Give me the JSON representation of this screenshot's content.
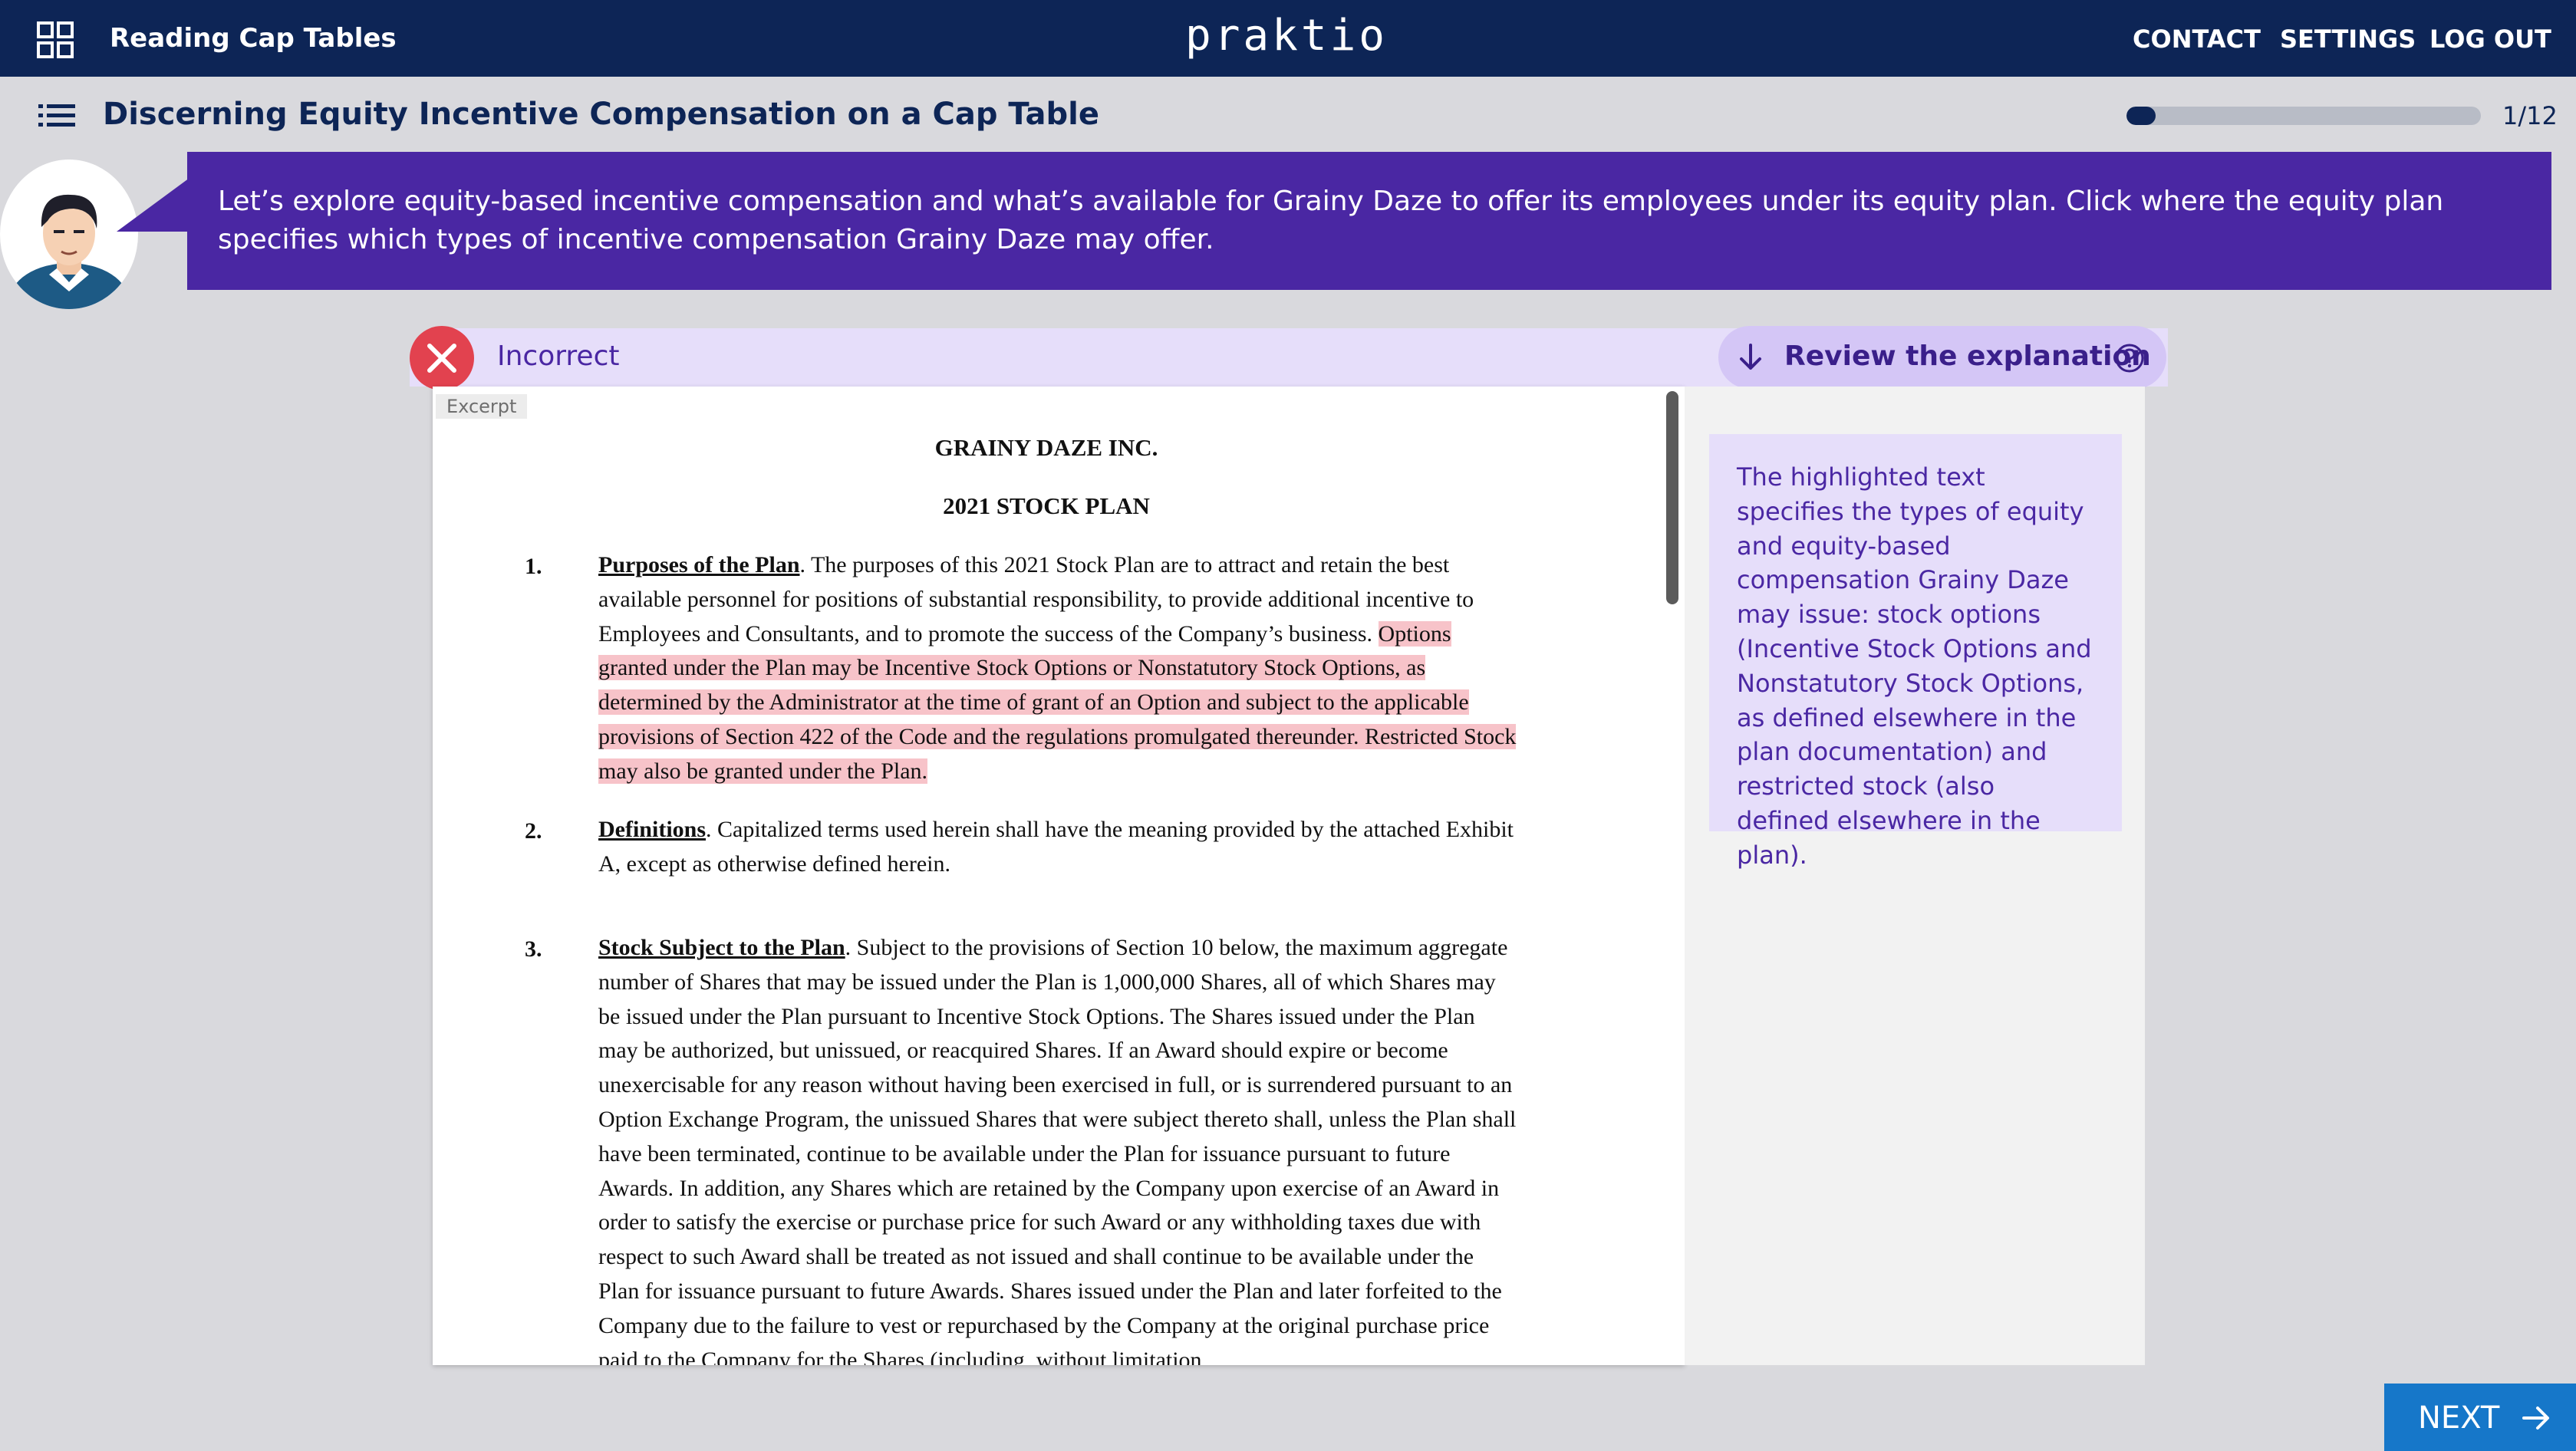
{
  "header": {
    "app_title": "Reading Cap Tables",
    "brand": "praktio",
    "nav": {
      "contact": "CONTACT",
      "settings": "SETTINGS",
      "logout": "LOG OUT"
    }
  },
  "lesson": {
    "title": "Discerning Equity Incentive Compensation on a Cap Table",
    "progress_label": "1/12",
    "progress_fraction": 0.083
  },
  "prompt": {
    "text": "Let’s explore equity-based incentive compensation and what’s available for Grainy Daze to offer its employees under its equity plan. Click where the equity plan specifies which types of incentive compensation Grainy Daze may offer."
  },
  "feedback": {
    "status_label": "Incorrect",
    "review_label": "Review the explanation"
  },
  "document": {
    "excerpt_tag": "Excerpt",
    "company": "GRAINY DAZE INC.",
    "plan_title": "2021 STOCK PLAN",
    "sections": [
      {
        "number": "1.",
        "heading": "Purposes of the Plan",
        "text": ". The purposes of this 2021 Stock Plan are to attract and retain the best available personnel for positions of substantial responsibility, to provide additional incentive to Employees and Consultants, and to promote the success of the Company’s business. ",
        "highlight": "Options granted under the Plan may be Incentive Stock Options or Nonstatutory Stock Options, as determined by the Administrator at the time of grant of an Option and subject to the applicable provisions of Section 422 of the Code and the regulations promulgated thereunder. Restricted Stock may also be granted under the Plan."
      },
      {
        "number": "2.",
        "heading": "Definitions",
        "text": ". Capitalized terms used herein shall have the meaning provided by the attached Exhibit A, except as otherwise defined herein."
      },
      {
        "number": "3.",
        "heading": "Stock Subject to the Plan",
        "text": ". Subject to the provisions of Section 10 below, the maximum aggregate number of Shares that may be issued under the Plan is 1,000,000 Shares, all of which Shares may be issued under the Plan pursuant to Incentive Stock Options. The Shares issued under the Plan may be authorized, but unissued, or reacquired Shares. If an Award should expire or become unexercisable for any reason without having been exercised in full, or is surrendered pursuant to an Option Exchange Program, the unissued Shares that were subject thereto shall, unless the Plan shall have been terminated, continue to be available under the Plan for issuance pursuant to future Awards. In addition, any Shares which are retained by the Company upon exercise of an Award in order to satisfy the exercise or purchase price for such Award or any withholding taxes due with respect to such Award shall be treated as not issued and shall continue to be available under the Plan for issuance pursuant to future Awards. Shares issued under the Plan and later forfeited to the Company due to the failure to vest or repurchased by the Company at the original purchase price paid to the Company for the Shares (including, without limitation,"
      }
    ]
  },
  "explanation": {
    "text": "The highlighted text specifies the types of equity and equity-based compensation Grainy Daze may issue: stock options (Incentive Stock Options and Nonstatutory Stock Options, as defined elsewhere in the plan documentation) and restricted stock (also defined elsewhere in the plan)."
  },
  "footer": {
    "next_label": "NEXT"
  },
  "colors": {
    "topbar": "#0d2556",
    "banner": "#4a27a3",
    "incorrect_badge": "#e2424f",
    "highlight": "#f7c3c9",
    "next_button": "#1677c9"
  }
}
